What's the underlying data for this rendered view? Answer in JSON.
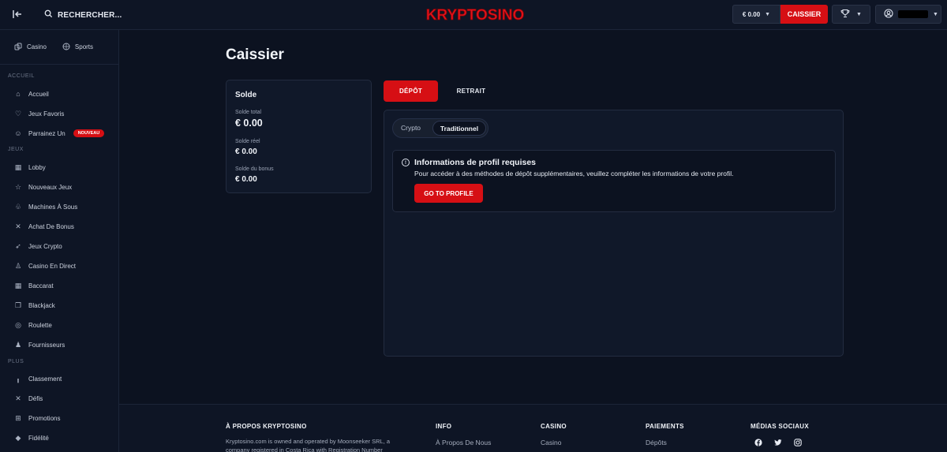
{
  "header": {
    "search_placeholder": "RECHERCHER...",
    "logo_text": "KRYPTOSINO",
    "balance": "€ 0.00",
    "cashier_label": "CAISSIER"
  },
  "sidebar": {
    "top": [
      {
        "label": "Casino",
        "icon": "casino-icon"
      },
      {
        "label": "Sports",
        "icon": "sports-icon"
      }
    ],
    "sections": {
      "accueil": "ACCUEIL",
      "jeux": "JEUX",
      "plus": "PLUS"
    },
    "accueil_items": [
      {
        "label": "Accueil"
      },
      {
        "label": "Jeux Favoris"
      },
      {
        "label": "Parrainez Un",
        "badge": "NOUVEAU"
      }
    ],
    "jeux_items": [
      {
        "label": "Lobby"
      },
      {
        "label": "Nouveaux Jeux"
      },
      {
        "label": "Machines À Sous"
      },
      {
        "label": "Achat De Bonus"
      },
      {
        "label": "Jeux Crypto"
      },
      {
        "label": "Casino En Direct"
      },
      {
        "label": "Baccarat"
      },
      {
        "label": "Blackjack"
      },
      {
        "label": "Roulette"
      },
      {
        "label": "Fournisseurs"
      }
    ],
    "plus_items": [
      {
        "label": "Classement"
      },
      {
        "label": "Défis"
      },
      {
        "label": "Promotions"
      },
      {
        "label": "Fidélité"
      }
    ]
  },
  "main": {
    "title": "Caissier",
    "balance_card": {
      "heading": "Solde",
      "rows": [
        {
          "label": "Solde total",
          "value": "€ 0.00"
        },
        {
          "label": "Solde réel",
          "value": "€ 0.00"
        },
        {
          "label": "Solde du bonus",
          "value": "€ 0.00"
        }
      ]
    },
    "tabs": {
      "depot": "DÉPÔT",
      "retrait": "RETRAIT"
    },
    "method_toggle": {
      "crypto": "Crypto",
      "traditionnel": "Traditionnel"
    },
    "info": {
      "title": "Informations de profil requises",
      "text": "Pour accéder à des méthodes de dépôt supplémentaires, veuillez compléter les informations de votre profil.",
      "button": "GO TO PROFILE"
    }
  },
  "footer": {
    "about_title": "À PROPOS KRYPTOSINO",
    "about_text": "Kryptosino.com is owned and operated by Moonseeker SRL, a company registered in Costa Rica with Registration Number",
    "info_title": "INFO",
    "info_link": "À Propos De Nous",
    "casino_title": "CASINO",
    "casino_link": "Casino",
    "payments_title": "PAIEMENTS",
    "payments_link": "Dépôts",
    "social_title": "MÉDIAS SOCIAUX"
  },
  "colors": {
    "accent": "#d60f14",
    "background": "#0c1220",
    "panel": "#101829"
  }
}
